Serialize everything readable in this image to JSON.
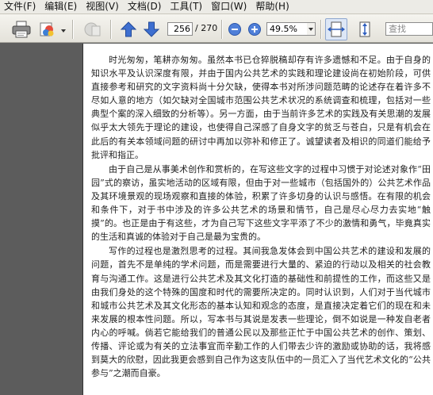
{
  "menu": {
    "items": [
      "文件(F)",
      "编辑(E)",
      "视图(V)",
      "文档(D)",
      "工具(T)",
      "窗口(W)",
      "帮助(H)"
    ]
  },
  "toolbar": {
    "current_page": "256",
    "total_pages": "/ 270",
    "zoom": "49.5%",
    "search_placeholder": "查找"
  },
  "colors": {
    "nav_arrow": "#3e6fd0",
    "zoom_circle": "#4f7fd8",
    "page_bg": "#ffffff",
    "viewer_bg": "#5c5c5c"
  },
  "document": {
    "paragraphs": [
      "时光匆匆，笔耕亦匆匆。虽然本书已仓猝脱稿却存有许多遗憾和不足。由于自身的知识水平及认识深度有限，并由于国内公共艺术的实践和理论建设尚在初始阶段，可供直接参考和研究的文字资料尚十分欠缺，使得本书对所涉问题范畴的论述存在着许多不尽如人意的地方（如欠缺对全国城市范围公共艺术状况的系统调查和梳理，包括对一些典型个案的深入细致的分析等）。另一方面，由于当前许多艺术的实践及有关思潮的发展似乎太大领先于理论的建设，也使得自己深感了自身文字的贫乏与苍白，只是有机会在此后的有关本领域问题的研讨中再加以弥补和修正了。诚望读者及相识的同道们能给予批评和指正。",
      "由于自己是从事美术创作和赏析的，在写这些文字的过程中习惯于对论述对象作“田园”式的察访，虽实地活动的区域有限，但由于对一些城市（包括国外的）公共艺术作品及其环境景观的现场观察和直接的体验，积累了许多切身的认识与感悟。在有限的机会和条件下，对于书中涉及的许多公共艺术的场景和情节，自己是尽心尽力去实地“触摸”的。也正是由于有这些，才为自己写下这些文字平添了不少的激情和勇气，毕竟真实的生活和真诚的体验对于自己是最为宝贵的。",
      "写作的过程也是激烈思考的过程。其间我急发体会到中国公共艺术的建设和发展的问题，首先不是单纯的学术问题，而是需要进行大量的、紧迫的行动以及相关的社会教育与沟通工作。这是进行公共艺术及其文化打造的基础性和前提性的工作，而这些又是由我们身处的这个特殊的国度和时代的需要所决定的。同时认识到，人们对于当代城市和城市公共艺术及其文化形态的基本认知和观念的态度，是直接决定着它们的现在和未来发展的根本性问题。所以，写本书与其说是发表一些理论，倒不如说是一种发自老者内心的呼喊。倘若它能给我们的普通公民以及那些正忙于中国公共艺术的创作、策划、传播、评论或为有关的立法事宜而辛勤工作的人们带去少许的激励或协助的话，我将感到莫大的欣慰，因此我更会感到自己作为这支队伍中的一员汇入了当代艺术文化的“公共参与”之潮而自豪。"
    ]
  }
}
